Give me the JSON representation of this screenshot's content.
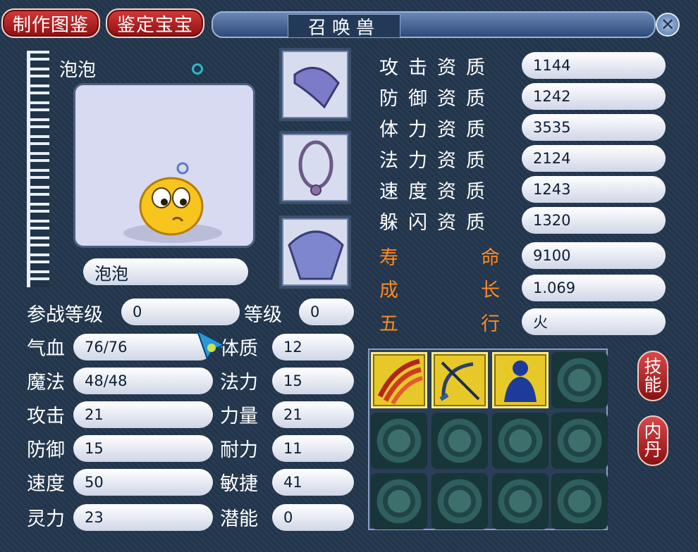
{
  "header": {
    "tab_make": "制作图鉴",
    "tab_appraise": "鉴定宝宝",
    "title": "召唤兽",
    "close_glyph": "✕"
  },
  "pet": {
    "display_name": "泡泡",
    "name_field": "泡泡"
  },
  "stats_left": {
    "level_label": "参战等级",
    "level_value": "0",
    "grade_label": "等级",
    "grade_value": "0",
    "rows": [
      {
        "label": "气血",
        "value": "76/76",
        "label2": "体质",
        "value2": "12"
      },
      {
        "label": "魔法",
        "value": "48/48",
        "label2": "法力",
        "value2": "15"
      },
      {
        "label": "攻击",
        "value": "21",
        "label2": "力量",
        "value2": "21"
      },
      {
        "label": "防御",
        "value": "15",
        "label2": "耐力",
        "value2": "11"
      },
      {
        "label": "速度",
        "value": "50",
        "label2": "敏捷",
        "value2": "41"
      },
      {
        "label": "灵力",
        "value": "23",
        "label2": "潜能",
        "value2": "0"
      }
    ]
  },
  "aptitudes": [
    {
      "label": "攻击资质",
      "value": "1144"
    },
    {
      "label": "防御资质",
      "value": "1242"
    },
    {
      "label": "体力资质",
      "value": "3535"
    },
    {
      "label": "法力资质",
      "value": "2124"
    },
    {
      "label": "速度资质",
      "value": "1243"
    },
    {
      "label": "躲闪资质",
      "value": "1320"
    }
  ],
  "special": [
    {
      "label_a": "寿",
      "label_b": "命",
      "value": "9100"
    },
    {
      "label_a": "成",
      "label_b": "长",
      "value": "1.069"
    },
    {
      "label_a": "五",
      "label_b": "行",
      "value": "火"
    }
  ],
  "side_buttons": {
    "skills": "技能",
    "inner_pill": "内丹"
  },
  "colors": {
    "accent_red": "#b31c1f",
    "label_orange": "#ff8a1e",
    "skill_gold": "#e6c928"
  }
}
